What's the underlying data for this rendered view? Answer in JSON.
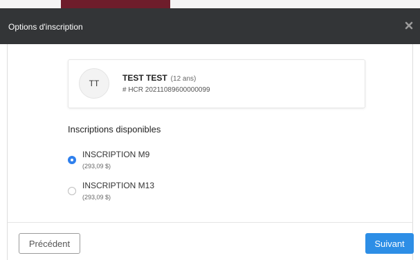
{
  "modal": {
    "title": "Options d'inscription",
    "close_icon": "close-icon"
  },
  "member": {
    "initials": "TT",
    "name": "TEST TEST",
    "age": "(12 ans)",
    "id": "# HCR 20211089600000099"
  },
  "section": {
    "title": "Inscriptions disponibles"
  },
  "options": [
    {
      "label": "INSCRIPTION M9",
      "price": "(293,09 $)",
      "selected": true
    },
    {
      "label": "INSCRIPTION M13",
      "price": "(293,09 $)",
      "selected": false
    }
  ],
  "footer": {
    "previous_label": "Précédent",
    "next_label": "Suivant"
  },
  "colors": {
    "header_bg": "#333537",
    "accent": "#2d8ee6",
    "backdrop_accent": "#6e1d2b"
  }
}
